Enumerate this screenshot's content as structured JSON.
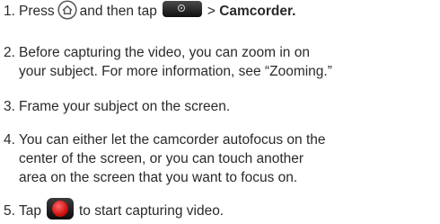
{
  "steps": [
    {
      "number": "1.",
      "text_a": "Press",
      "text_b": "and then tap",
      "text_c": ">",
      "target": "Camcorder."
    },
    {
      "number": "2.",
      "line1": "Before capturing the video, you can zoom in on",
      "line2": "your subject. For more information, see “Zooming.”"
    },
    {
      "number": "3.",
      "line1": "Frame your subject on the screen."
    },
    {
      "number": "4.",
      "line1": "You can either let the camcorder autofocus on the",
      "line2": "center of the screen, or you can touch another",
      "line3": "area on the screen that you want to focus on."
    },
    {
      "number": "5.",
      "text_a": "Tap",
      "text_b": "to start capturing video."
    }
  ],
  "icons": {
    "home": "home-icon",
    "launcher": "all-apps-icon",
    "record": "record-icon"
  }
}
